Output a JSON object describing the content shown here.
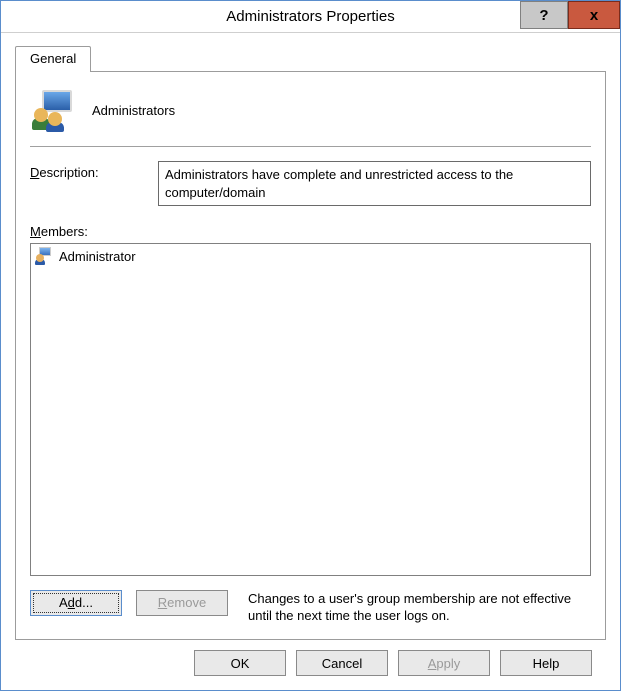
{
  "window": {
    "title": "Administrators Properties"
  },
  "tabs": [
    {
      "label": "General"
    }
  ],
  "group": {
    "name": "Administrators"
  },
  "description": {
    "label": "Description:",
    "value": "Administrators have complete and unrestricted access to the computer/domain"
  },
  "members": {
    "label": "Members:",
    "items": [
      {
        "name": "Administrator"
      }
    ]
  },
  "buttons": {
    "add": "Add...",
    "remove": "Remove",
    "ok": "OK",
    "cancel": "Cancel",
    "apply": "Apply",
    "help": "Help"
  },
  "note": "Changes to a user's group membership are not effective until the next time the user logs on."
}
